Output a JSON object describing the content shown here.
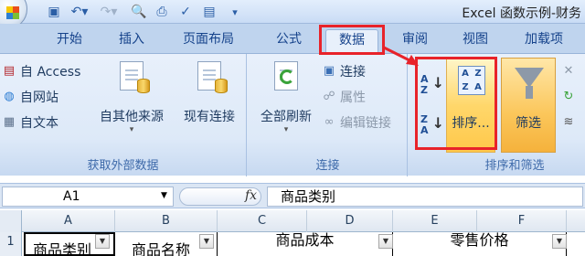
{
  "window": {
    "title": "Excel 函数示例-财务"
  },
  "quick_access": {
    "icons": [
      "save-icon",
      "undo-icon",
      "redo-icon",
      "print-preview-icon",
      "print-icon",
      "spell-check-icon",
      "customize-icon"
    ]
  },
  "tabs": [
    {
      "label": "开始"
    },
    {
      "label": "插入"
    },
    {
      "label": "页面布局"
    },
    {
      "label": "公式"
    },
    {
      "label": "数据",
      "active": true
    },
    {
      "label": "审阅"
    },
    {
      "label": "视图"
    },
    {
      "label": "加载项"
    }
  ],
  "ribbon": {
    "get_external": {
      "label": "获取外部数据",
      "access": "自 Access",
      "web": "自网站",
      "text": "自文本",
      "other": "自其他来源",
      "existing": "现有连接"
    },
    "connections": {
      "label": "连接",
      "refresh_all": "全部刷新",
      "connections_btn": "连接",
      "properties": "属性",
      "edit_links": "编辑链接"
    },
    "sort_filter": {
      "label": "排序和筛选",
      "sort": "排序...",
      "filter": "筛选",
      "az_top": "A",
      "az_bottom": "Z",
      "za_top": "Z",
      "za_bottom": "A"
    }
  },
  "formula_bar": {
    "name_box": "A1",
    "fx": "fx",
    "content": "商品类别"
  },
  "grid": {
    "columns": [
      "A",
      "B",
      "C",
      "D",
      "E",
      "F"
    ],
    "row_number": "1",
    "cells": {
      "a1": "商品类别",
      "b1": "商品名称",
      "cd1": "商品成本",
      "ef1": "零售价格"
    }
  },
  "annotation_color": "#e8232a"
}
